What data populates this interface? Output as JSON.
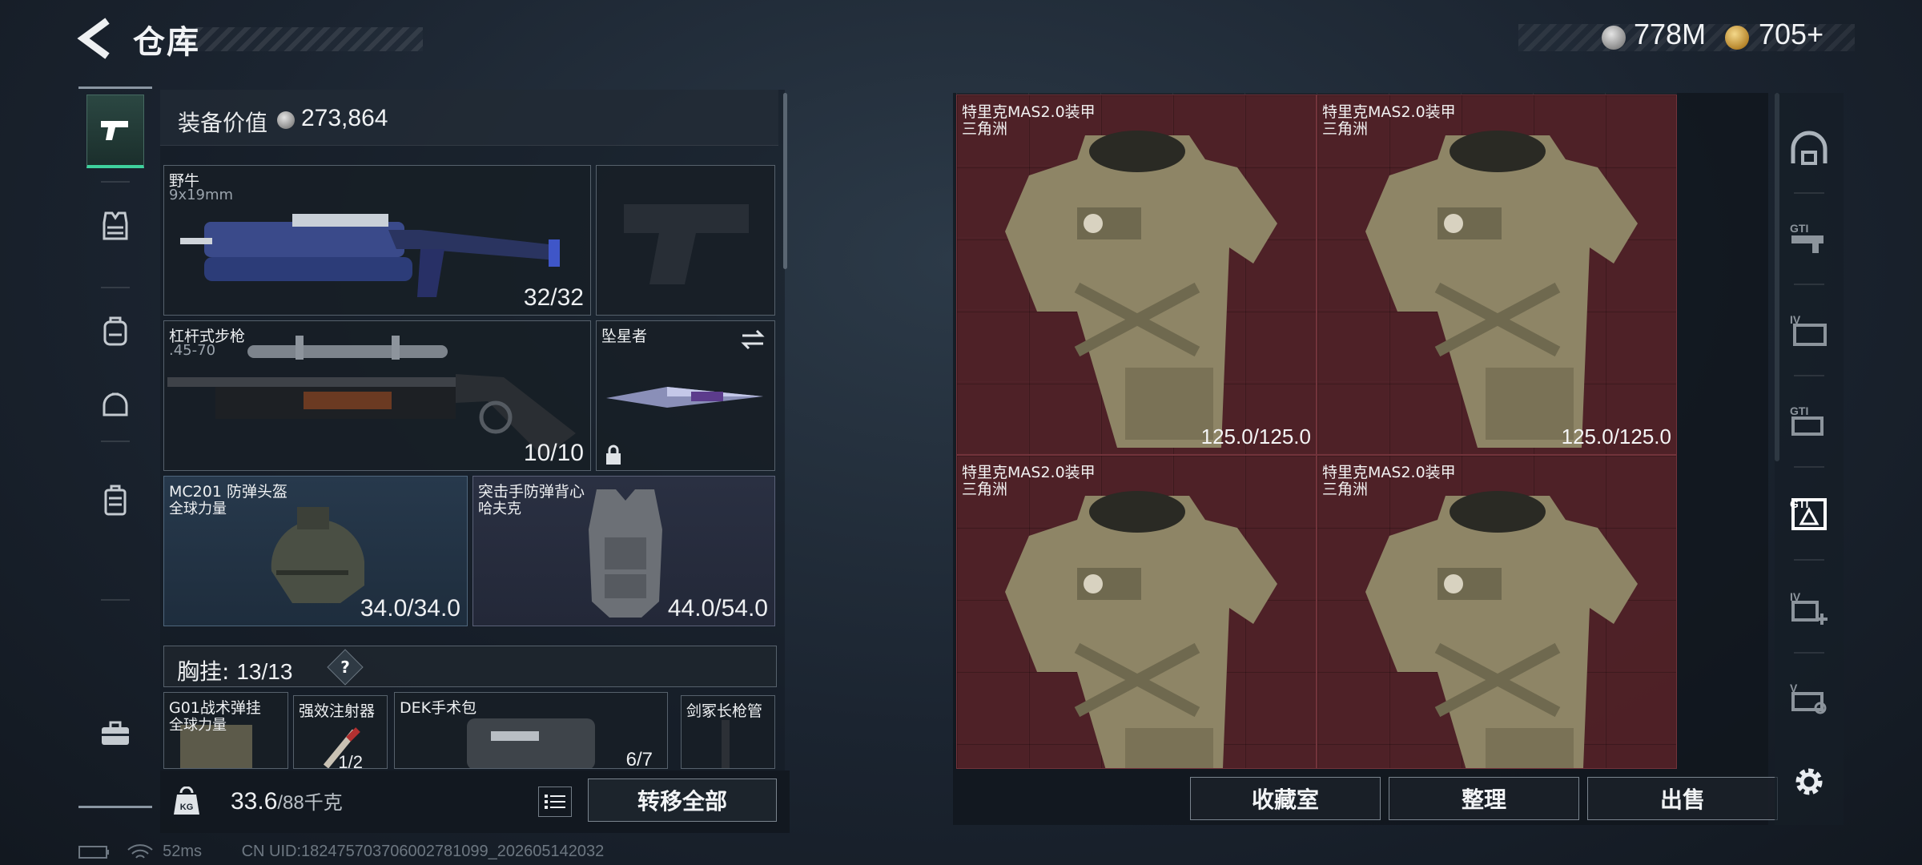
{
  "header": {
    "title": "仓库",
    "currency_1": "778M",
    "currency_2": "705+"
  },
  "left_rail": {
    "items": [
      "handgun-icon",
      "vest-icon",
      "backpack-icon",
      "helmet-bag-icon",
      "case-icon",
      "toolbox-icon"
    ],
    "active_index": 0
  },
  "loadout": {
    "value_label": "装备价值",
    "value": "273,864",
    "primary": {
      "name": "野牛",
      "sub": "9x19mm",
      "count": "32/32"
    },
    "secondary": {
      "name": "杠杆式步枪",
      "sub": ".45-70",
      "count": "10/10"
    },
    "melee": {
      "name": "坠星者"
    },
    "helmet": {
      "name": "MC201 防弹头盔",
      "sub": "全球力量",
      "durability": "34.0/34.0"
    },
    "armor": {
      "name": "突击手防弹背心",
      "sub": "哈夫克",
      "durability": "44.0/54.0"
    },
    "chest_label": "胸挂:",
    "chest_count": "13/13",
    "chest_help": "?",
    "chest_items": [
      {
        "name": "G01战术弹挂",
        "sub": "全球力量"
      },
      {
        "name": "强效注射器",
        "sub": "1/2"
      },
      {
        "name": "DEK手术包",
        "count": "6/7"
      },
      {
        "name": "剑冢长枪管"
      }
    ],
    "weight_current": "33.6",
    "weight_max": "/88千克",
    "weight_badge": "KG",
    "transfer_all": "转移全部"
  },
  "stash": {
    "items": [
      {
        "name": "特里克MAS2.0装甲",
        "sub": "三角洲",
        "durability": "125.0/125.0"
      },
      {
        "name": "特里克MAS2.0装甲",
        "sub": "三角洲",
        "durability": "125.0/125.0"
      },
      {
        "name": "特里克MAS2.0装甲",
        "sub": "三角洲",
        "durability": ""
      },
      {
        "name": "特里克MAS2.0装甲",
        "sub": "三角洲",
        "durability": ""
      }
    ],
    "buttons": {
      "collection": "收藏室",
      "sort": "整理",
      "sell": "出售"
    }
  },
  "right_rail": {
    "items": [
      "dome-icon",
      "gti-weapon-icon",
      "iv-folder-icon",
      "gti-gear-icon",
      "gti-warning-icon",
      "iv-add-icon",
      "v-search-icon",
      "settings-gear-icon"
    ],
    "active_index": 4
  },
  "status": {
    "ping": "52ms",
    "uid": "CN UID:1824757037060027810​99_202605142032"
  },
  "colors": {
    "accent": "#3fd19d",
    "stash_cell": "#56222a"
  }
}
